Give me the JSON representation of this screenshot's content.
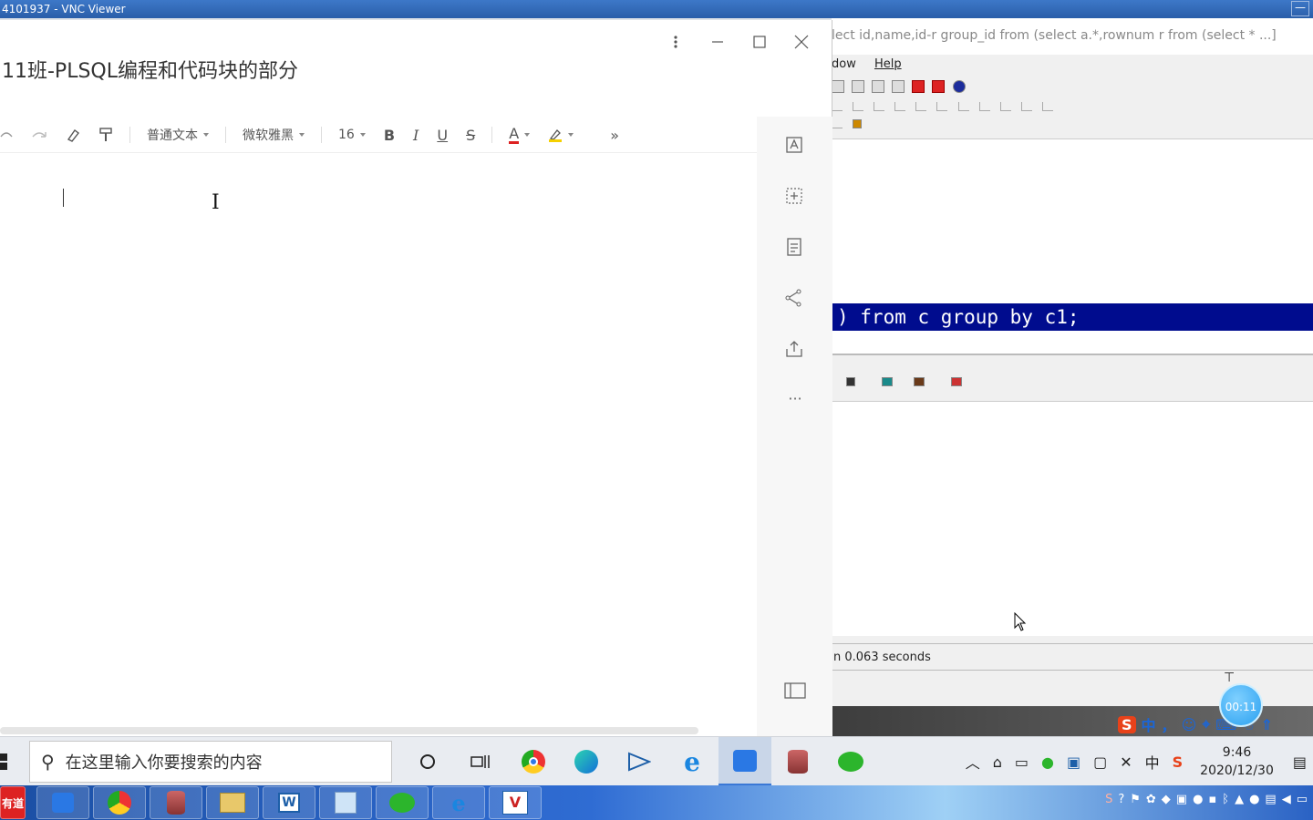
{
  "vnc": {
    "title": "4101937 - VNC Viewer",
    "minimize": "—"
  },
  "bg_app": {
    "title_text": "lect id,name,id-r group_id from (select a.*,rownum r from (select * ...]",
    "menu": [
      "dow",
      "Help"
    ],
    "sql_line": ") from c group by c1;",
    "status": "n 0.063 seconds"
  },
  "note": {
    "title": "11班-PLSQL编程和代码块的部分",
    "toolbar": {
      "style": "普通文本",
      "font": "微软雅黑",
      "size": "16",
      "bold": "B",
      "italic": "I",
      "underline": "U",
      "strike": "S",
      "color": "A",
      "more": "»"
    },
    "rail_more": "···"
  },
  "overlay": {
    "timer": "00:11"
  },
  "ime": {
    "lang": "中",
    "punct": "，"
  },
  "taskbar": {
    "search_placeholder": "在这里输入你要搜索的内容",
    "ime_tray": "中",
    "time": "9:46",
    "date": "2020/12/30"
  },
  "outer_taskbar": {
    "first_label": "有道"
  }
}
